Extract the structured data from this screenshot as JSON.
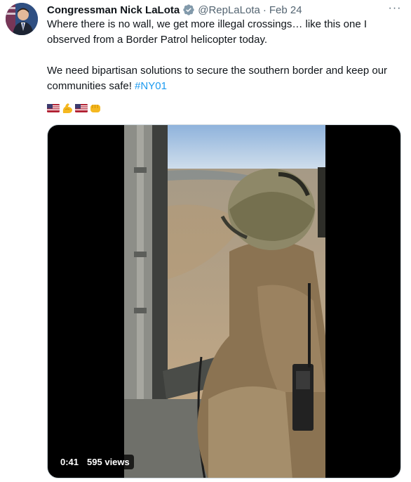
{
  "author": {
    "name": "Congressman Nick LaLota",
    "handle": "@RepLaLota",
    "separator": "·",
    "date": "Feb 24"
  },
  "tweet": {
    "line1": "Where there is no wall, we get more illegal crossings… like this one I observed from a Border Patrol helicopter today.",
    "line2": "We need bipartisan solutions to secure the southern border and keep our communities safe! ",
    "hashtag": "#NY01",
    "emojis": [
      "us-flag-icon",
      "flexed-biceps-icon",
      "us-flag-icon",
      "oncoming-fist-icon"
    ]
  },
  "menu": {
    "more_label": "···"
  },
  "video": {
    "duration": "0:41",
    "views": "595 views"
  },
  "colors": {
    "text": "#0f1419",
    "secondary": "#536471",
    "link": "#1d9bf0",
    "verified": "#829aab"
  }
}
